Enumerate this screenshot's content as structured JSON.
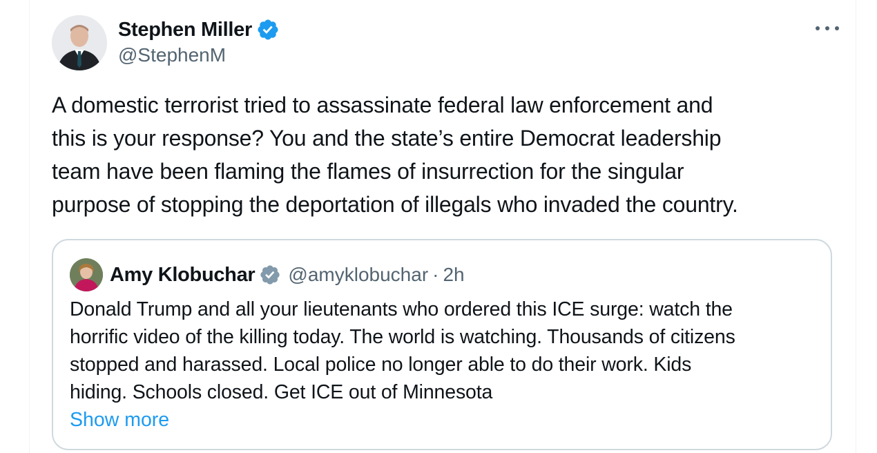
{
  "tweet": {
    "author": {
      "display_name": "Stephen Miller",
      "handle": "@StephenM",
      "verified_icon": "verified-badge-blue",
      "verified_color": "#1d9bf0"
    },
    "more_icon": "more-horizontal-icon",
    "text": "A domestic terrorist tried to assassinate federal law enforcement and\nthis is your response? You and the state’s entire Democrat leadership\nteam have been flaming the flames of insurrection for the singular\npurpose of stopping the deportation of illegals who invaded the country."
  },
  "quote": {
    "author": {
      "display_name": "Amy Klobuchar",
      "handle": "@amyklobuchar",
      "verified_icon": "verified-badge-gray",
      "verified_color": "#829aab"
    },
    "separator": "·",
    "time": "2h",
    "text": "Donald Trump and all your lieutenants who ordered this ICE surge: watch the\nhorrific video of the killing today. The world is watching. Thousands  of citizens\nstopped and harassed. Local police no longer able to do their work. Kids\nhiding. Schools closed. Get ICE out of Minnesota",
    "show_more_label": "Show more"
  },
  "colors": {
    "text_primary": "#0f1419",
    "text_secondary": "#536471",
    "link": "#1d9bf0",
    "border": "#cfd9de"
  }
}
